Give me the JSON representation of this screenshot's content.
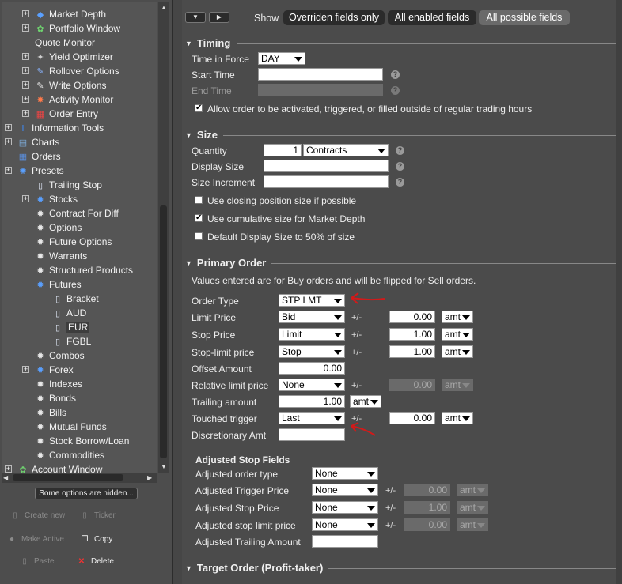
{
  "tree": {
    "items": [
      {
        "label": "Market Depth",
        "icon": "market-depth-icon",
        "glyph": "◆",
        "color": "#5aa0ff",
        "level": 2,
        "expand": true
      },
      {
        "label": "Portfolio Window",
        "icon": "portfolio-icon",
        "glyph": "✿",
        "color": "#6fd36f",
        "level": 2,
        "expand": true
      },
      {
        "label": "Quote Monitor",
        "icon": "",
        "glyph": "",
        "color": "",
        "level": 2,
        "expand": false
      },
      {
        "label": "Yield Optimizer",
        "icon": "yield-optimizer-icon",
        "glyph": "✦",
        "color": "#cfcfcf",
        "level": 2,
        "expand": true
      },
      {
        "label": "Rollover Options",
        "icon": "rollover-icon",
        "glyph": "✎",
        "color": "#8ab4ff",
        "level": 2,
        "expand": true
      },
      {
        "label": "Write Options",
        "icon": "write-options-icon",
        "glyph": "✎",
        "color": "#e0e0e0",
        "level": 2,
        "expand": true
      },
      {
        "label": "Activity Monitor",
        "icon": "activity-monitor-icon",
        "glyph": "✸",
        "color": "#ff7a4a",
        "level": 2,
        "expand": true
      },
      {
        "label": "Order Entry",
        "icon": "order-entry-icon",
        "glyph": "▦",
        "color": "#e44",
        "level": 2,
        "expand": true
      },
      {
        "label": "Information Tools",
        "icon": "info-icon",
        "glyph": "i",
        "color": "#3b8cff",
        "level": 1,
        "expand": true
      },
      {
        "label": "Charts",
        "icon": "chart-icon",
        "glyph": "▤",
        "color": "#7fb0e0",
        "level": 1,
        "expand": true
      },
      {
        "label": "Orders",
        "icon": "orders-icon",
        "glyph": "▦",
        "color": "#5a8fe0",
        "level": 1,
        "expand": false
      },
      {
        "label": "Presets",
        "icon": "presets-icon",
        "glyph": "✺",
        "color": "#5aa0ff",
        "level": 1,
        "expand": true
      },
      {
        "label": "Trailing Stop",
        "icon": "trailing-stop-icon",
        "glyph": "▯",
        "color": "#dfe6f5",
        "level": 2,
        "expand": false
      },
      {
        "label": "Stocks",
        "icon": "gear-icon",
        "glyph": "✹",
        "color": "#5aa0ff",
        "level": 2,
        "expand": true
      },
      {
        "label": "Contract For Diff",
        "icon": "gear-icon",
        "glyph": "✹",
        "color": "#e8e8e8",
        "level": 2,
        "expand": false
      },
      {
        "label": "Options",
        "icon": "gear-icon",
        "glyph": "✹",
        "color": "#e8e8e8",
        "level": 2,
        "expand": false
      },
      {
        "label": "Future Options",
        "icon": "gear-icon",
        "glyph": "✹",
        "color": "#e8e8e8",
        "level": 2,
        "expand": false
      },
      {
        "label": "Warrants",
        "icon": "gear-icon",
        "glyph": "✹",
        "color": "#e8e8e8",
        "level": 2,
        "expand": false
      },
      {
        "label": "Structured Products",
        "icon": "gear-icon",
        "glyph": "✹",
        "color": "#e8e8e8",
        "level": 2,
        "expand": false
      },
      {
        "label": "Futures",
        "icon": "gear-icon",
        "glyph": "✹",
        "color": "#5aa0ff",
        "level": 2,
        "expand": false
      },
      {
        "label": "Bracket",
        "icon": "preset-file-icon",
        "glyph": "▯",
        "color": "#dfe6f5",
        "level": 3,
        "expand": false
      },
      {
        "label": "AUD",
        "icon": "preset-file-icon",
        "glyph": "▯",
        "color": "#dfe6f5",
        "level": 3,
        "expand": false
      },
      {
        "label": "EUR",
        "icon": "preset-file-icon",
        "glyph": "▯",
        "color": "#dfe6f5",
        "level": 3,
        "expand": false
      },
      {
        "label": "FGBL",
        "icon": "preset-file-icon",
        "glyph": "▯",
        "color": "#dfe6f5",
        "level": 3,
        "expand": false
      },
      {
        "label": "Combos",
        "icon": "gear-icon",
        "glyph": "✹",
        "color": "#e8e8e8",
        "level": 2,
        "expand": false
      },
      {
        "label": "Forex",
        "icon": "gear-icon",
        "glyph": "✹",
        "color": "#5aa0ff",
        "level": 2,
        "expand": true
      },
      {
        "label": "Indexes",
        "icon": "gear-icon",
        "glyph": "✹",
        "color": "#e8e8e8",
        "level": 2,
        "expand": false
      },
      {
        "label": "Bonds",
        "icon": "gear-icon",
        "glyph": "✹",
        "color": "#e8e8e8",
        "level": 2,
        "expand": false
      },
      {
        "label": "Bills",
        "icon": "gear-icon",
        "glyph": "✹",
        "color": "#e8e8e8",
        "level": 2,
        "expand": false
      },
      {
        "label": "Mutual Funds",
        "icon": "gear-icon",
        "glyph": "✹",
        "color": "#e8e8e8",
        "level": 2,
        "expand": false
      },
      {
        "label": "Stock Borrow/Loan",
        "icon": "gear-icon",
        "glyph": "✹",
        "color": "#e8e8e8",
        "level": 2,
        "expand": false
      },
      {
        "label": "Commodities",
        "icon": "gear-icon",
        "glyph": "✹",
        "color": "#e8e8e8",
        "level": 2,
        "expand": false
      },
      {
        "label": "Account Window",
        "icon": "account-window-icon",
        "glyph": "✿",
        "color": "#6fd36f",
        "level": 1,
        "expand": true
      }
    ],
    "selected": "EUR"
  },
  "left_actions": {
    "hidden_label": "Some options are hidden...",
    "create_new": "Create new",
    "ticker": "Ticker",
    "make_active": "Make Active",
    "copy": "Copy",
    "paste": "Paste",
    "delete": "Delete"
  },
  "toolbar": {
    "show_label": "Show",
    "overridden": "Overriden fields only",
    "enabled": "All enabled fields",
    "possible": "All possible fields",
    "active": "possible"
  },
  "timing": {
    "title": "Timing",
    "tif_label": "Time in Force",
    "tif_value": "DAY",
    "start_label": "Start Time",
    "start_value": "",
    "end_label": "End Time",
    "end_value": "",
    "outside_rth_label": "Allow order to be activated, triggered, or filled outside of regular trading hours",
    "outside_rth_checked": true
  },
  "size": {
    "title": "Size",
    "qty_label": "Quantity",
    "qty_value": "1",
    "qty_unit": "Contracts",
    "display_label": "Display Size",
    "display_value": "",
    "incr_label": "Size Increment",
    "incr_value": "",
    "closing_label": "Use closing position size if possible",
    "closing_checked": false,
    "cumulative_label": "Use cumulative size for Market Depth",
    "cumulative_checked": true,
    "default_display_label": "Default Display Size to 50% of size",
    "default_display_checked": false
  },
  "primary": {
    "title": "Primary Order",
    "note": "Values entered are for Buy orders and will be flipped for Sell orders.",
    "plus_minus": "+/-",
    "order_type_label": "Order Type",
    "order_type_value": "STP LMT",
    "limit_label": "Limit Price",
    "limit_ref": "Bid",
    "limit_offset": "0.00",
    "limit_unit": "amt",
    "stop_label": "Stop Price",
    "stop_ref": "Limit",
    "stop_offset": "1.00",
    "stop_unit": "amt",
    "stoplimit_label": "Stop-limit price",
    "stoplimit_ref": "Stop",
    "stoplimit_offset": "1.00",
    "stoplimit_unit": "amt",
    "offset_label": "Offset Amount",
    "offset_value": "0.00",
    "rel_label": "Relative limit price",
    "rel_ref": "None",
    "rel_offset": "0.00",
    "rel_unit": "amt",
    "trail_label": "Trailing amount",
    "trail_value": "1.00",
    "trail_unit": "amt",
    "touched_label": "Touched trigger",
    "touched_ref": "Last",
    "touched_offset": "0.00",
    "touched_unit": "amt",
    "disc_label": "Discretionary Amt",
    "disc_value": ""
  },
  "adjusted": {
    "title": "Adjusted Stop Fields",
    "plus_minus": "+/-",
    "type_label": "Adjusted order type",
    "type_value": "None",
    "trigger_label": "Adjusted Trigger Price",
    "trigger_ref": "None",
    "trigger_offset": "0.00",
    "trigger_unit": "amt",
    "stop_label": "Adjusted Stop Price",
    "stop_ref": "None",
    "stop_offset": "1.00",
    "stop_unit": "amt",
    "stoplimit_label": "Adjusted stop limit price",
    "stoplimit_ref": "None",
    "stoplimit_offset": "0.00",
    "stoplimit_unit": "amt",
    "trailing_label": "Adjusted Trailing Amount",
    "trailing_value": ""
  },
  "target": {
    "title": "Target Order (Profit-taker)"
  },
  "colors": {
    "panel": "#4b4b4b",
    "annotation_red": "#d21a1a"
  }
}
